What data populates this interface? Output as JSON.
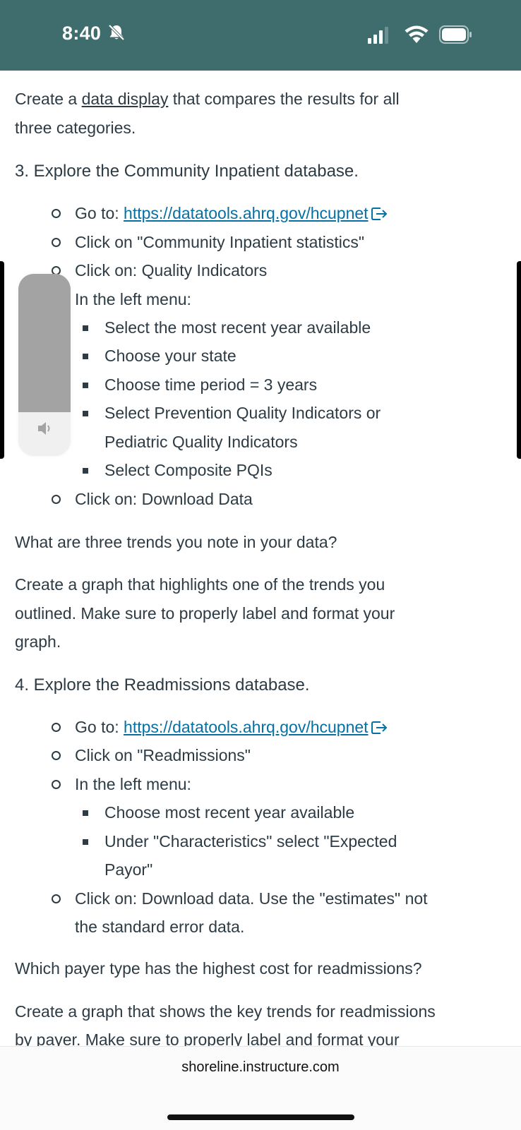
{
  "status_bar": {
    "time": "8:40"
  },
  "content": {
    "intro_prefix": "Create a ",
    "intro_link": "data display",
    "intro_suffix": " that compares the results for all",
    "intro_line2": "three categories.",
    "section3": {
      "heading": "3. Explore the Community Inpatient database.",
      "goto_prefix": "Go to: ",
      "goto_link": "https://datatools.ahrq.gov/hcupnet",
      "click1": "Click on \"Community Inpatient statistics\"",
      "click2": "Click on: Quality Indicators",
      "left_menu": "In the left menu:",
      "sub_items": [
        "Select the most recent year available",
        "Choose your state",
        "Choose time period = 3 years",
        "Select Prevention Quality Indicators or",
        "Pediatric Quality Indicators",
        "Select Composite PQIs"
      ],
      "download": "Click on:  Download Data"
    },
    "question1": "What are three trends you note in your data?",
    "question2_line1": "Create a graph that highlights one of the trends you",
    "question2_line2": "outlined.  Make sure to properly label and format your",
    "question2_line3": "graph.",
    "section4": {
      "heading": "4. Explore the Readmissions database.",
      "goto_prefix": "Go to: ",
      "goto_link": "https://datatools.ahrq.gov/hcupnet",
      "click1": "Click on \"Readmissions\"",
      "left_menu": "In the left menu:",
      "sub_items": [
        "Choose most recent year available",
        "Under \"Characteristics\" select \"Expected",
        "Payor\""
      ],
      "download_line1": "Click on:  Download data.  Use the \"estimates\" not",
      "download_line2": "the standard error data."
    },
    "question3": "Which payer type has the highest cost for readmissions?",
    "question4_line1": "Create a graph that shows the key trends for readmissions",
    "question4_line2": "by payer.  Make sure to properly label and format your"
  },
  "browser": {
    "url": "shoreline.instructure.com"
  },
  "colors": {
    "status_bar": "#3f6d6d",
    "link": "#0770a3",
    "text": "#2d3b45"
  }
}
